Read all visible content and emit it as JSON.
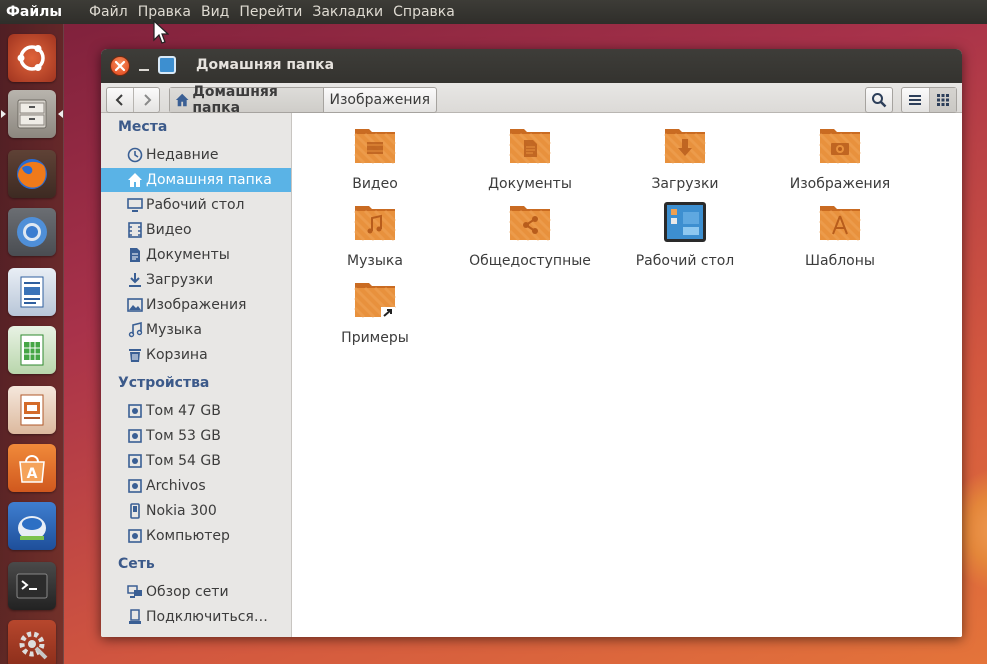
{
  "top_panel": {
    "app_title": "Файлы",
    "menu": [
      "Файл",
      "Правка",
      "Вид",
      "Перейти",
      "Закладки",
      "Справка"
    ]
  },
  "launcher": {
    "items": [
      "ubuntu-dash-icon",
      "files-icon",
      "firefox-icon",
      "chromium-icon",
      "writer-icon",
      "calc-icon",
      "impress-icon",
      "software-center-icon",
      "desktop-app-icon",
      "terminal-icon",
      "system-settings-icon"
    ]
  },
  "window": {
    "title": "Домашняя папка"
  },
  "toolbar": {
    "breadcrumbs": [
      "Домашняя папка",
      "Изображения"
    ]
  },
  "sidebar": {
    "places_heading": "Места",
    "places": [
      {
        "label": "Недавние",
        "icon": "clock-icon"
      },
      {
        "label": "Домашняя папка",
        "icon": "home-icon",
        "selected": true
      },
      {
        "label": "Рабочий стол",
        "icon": "desktop-icon"
      },
      {
        "label": "Видео",
        "icon": "film-icon"
      },
      {
        "label": "Документы",
        "icon": "document-icon"
      },
      {
        "label": "Загрузки",
        "icon": "download-icon"
      },
      {
        "label": "Изображения",
        "icon": "image-icon"
      },
      {
        "label": "Музыка",
        "icon": "music-icon"
      },
      {
        "label": "Корзина",
        "icon": "trash-icon"
      }
    ],
    "devices_heading": "Устройства",
    "devices": [
      {
        "label": "Том 47 GB",
        "icon": "drive-icon"
      },
      {
        "label": "Том 53 GB",
        "icon": "drive-icon"
      },
      {
        "label": "Том 54 GB",
        "icon": "drive-icon"
      },
      {
        "label": "Archivos",
        "icon": "drive-icon"
      },
      {
        "label": "Nokia 300",
        "icon": "phone-icon"
      },
      {
        "label": "Компьютер",
        "icon": "drive-icon"
      }
    ],
    "network_heading": "Сеть",
    "network": [
      {
        "label": "Обзор сети",
        "icon": "network-icon"
      },
      {
        "label": "Подключиться…",
        "icon": "connect-icon"
      }
    ]
  },
  "files": [
    {
      "label": "Видео",
      "icon": "folder-video-icon"
    },
    {
      "label": "Документы",
      "icon": "folder-documents-icon"
    },
    {
      "label": "Загрузки",
      "icon": "folder-download-icon"
    },
    {
      "label": "Изображения",
      "icon": "folder-pictures-icon"
    },
    {
      "label": "Музыка",
      "icon": "folder-music-icon"
    },
    {
      "label": "Общедоступные",
      "icon": "folder-publicshare-icon"
    },
    {
      "label": "Рабочий стол",
      "icon": "desktop-folder-icon"
    },
    {
      "label": "Шаблоны",
      "icon": "folder-templates-icon"
    },
    {
      "label": "Примеры",
      "icon": "folder-link-icon"
    }
  ],
  "colors": {
    "selection": "#5ab3e6",
    "folder": "#e8913d",
    "panel": "#3d3c37",
    "close_button": "#e0431a"
  }
}
